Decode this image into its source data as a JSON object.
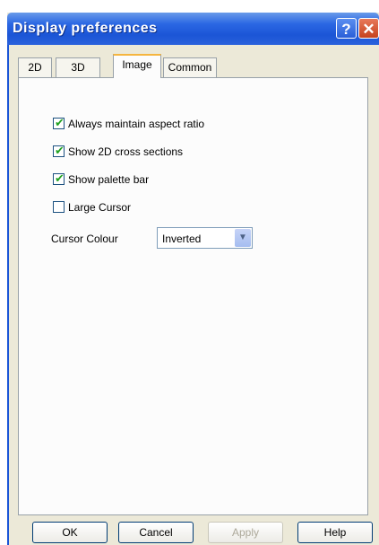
{
  "window": {
    "title": "Display preferences",
    "help_glyph": "?",
    "close_glyph": "✕"
  },
  "tabs": [
    {
      "label": "2D",
      "active": false
    },
    {
      "label": "3D",
      "active": false
    },
    {
      "label": "Image",
      "active": true
    },
    {
      "label": "Common",
      "active": false
    }
  ],
  "options": [
    {
      "label": "Always maintain aspect ratio",
      "checked": true
    },
    {
      "label": "Show 2D cross sections",
      "checked": true
    },
    {
      "label": "Show palette bar",
      "checked": true
    },
    {
      "label": "Large Cursor",
      "checked": false
    }
  ],
  "cursor_colour": {
    "label": "Cursor Colour",
    "value": "Inverted"
  },
  "buttons": {
    "ok": "OK",
    "cancel": "Cancel",
    "apply": "Apply",
    "help": "Help"
  },
  "colors": {
    "titlebar": "#2b67e3",
    "dialog_bg": "#ece9d8",
    "check": "#21a121",
    "tab_highlight": "#f5b53e"
  }
}
